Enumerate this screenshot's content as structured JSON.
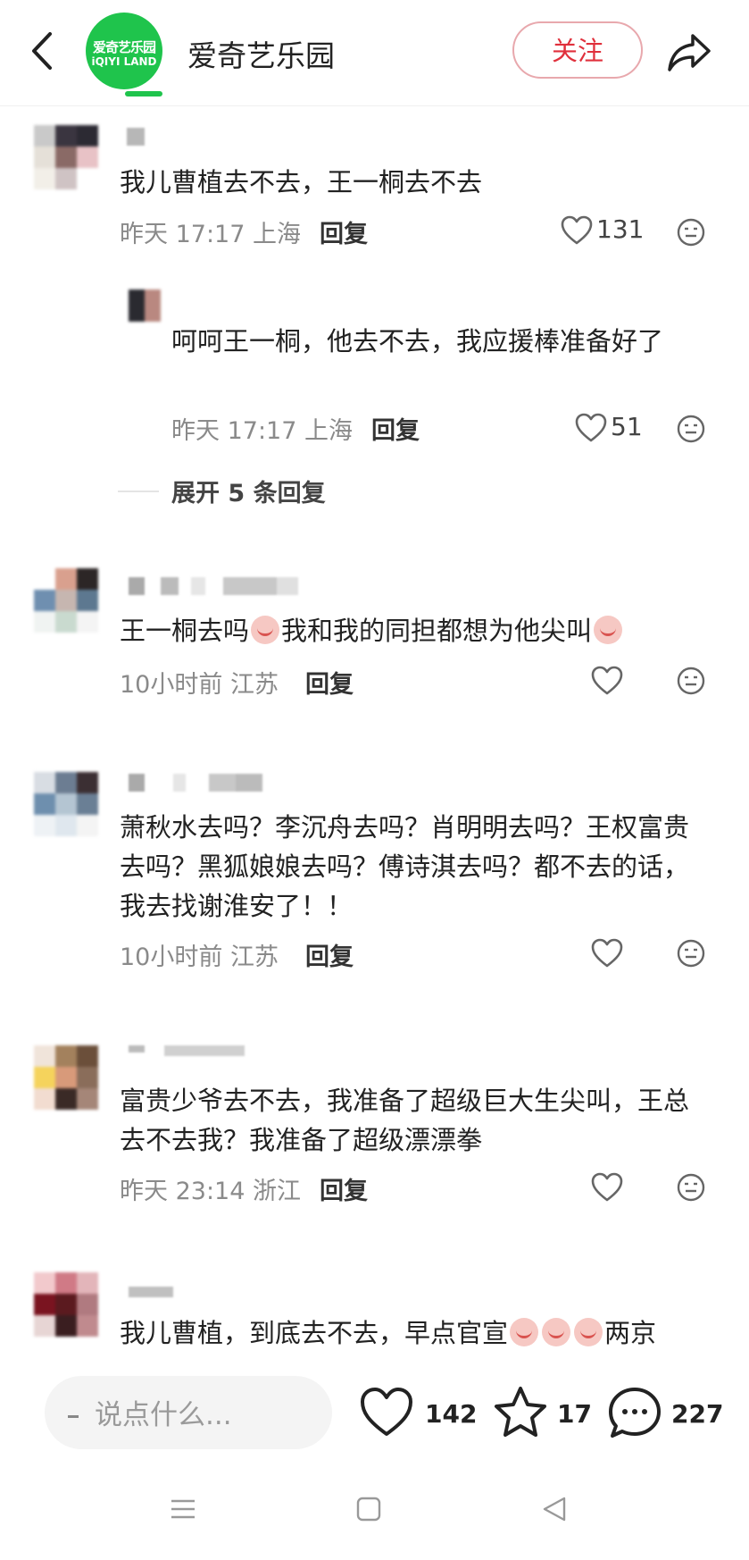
{
  "header": {
    "logo_line1": "爱奇艺乐园",
    "logo_line2": "iQIYI LAND",
    "title": "爱奇艺乐园",
    "follow_label": "关注"
  },
  "comments": [
    {
      "text": "我儿曹植去不去，王一桐去不去",
      "time": "昨天 17:17",
      "location": "上海",
      "reply": "回复",
      "likes": "131"
    },
    {
      "text": "呵呵王一桐，他去不去，我应援棒准备好了",
      "time": "昨天 17:17",
      "location": "上海",
      "reply": "回复",
      "likes": "51"
    },
    {
      "text_a": "王一桐去吗",
      "text_b": "我和我的同担都想为他尖叫",
      "time": "10小时前",
      "location": "江苏",
      "reply": "回复"
    },
    {
      "text": "萧秋水去吗？李沉舟去吗？肖明明去吗？王权富贵去吗？黑狐娘娘去吗？傅诗淇去吗？都不去的话，我去找谢淮安了！！",
      "time": "10小时前",
      "location": "江苏",
      "reply": "回复"
    },
    {
      "text": "富贵少爷去不去，我准备了超级巨大生尖叫，王总去不去我？我准备了超级漂漂拳",
      "time": "昨天 23:14",
      "location": "浙江",
      "reply": "回复"
    },
    {
      "text_a": "我儿曹植，到底去不去，早点官宣",
      "text_b": "两京"
    }
  ],
  "expand_label": "展开 5 条回复",
  "bottom": {
    "input_placeholder": "说点什么...",
    "likes": "142",
    "favorites": "17",
    "comments": "227"
  },
  "colors": {
    "brand_green": "#1fc44c",
    "follow_red": "#e0303c",
    "meta_gray": "#8a8a8a"
  }
}
